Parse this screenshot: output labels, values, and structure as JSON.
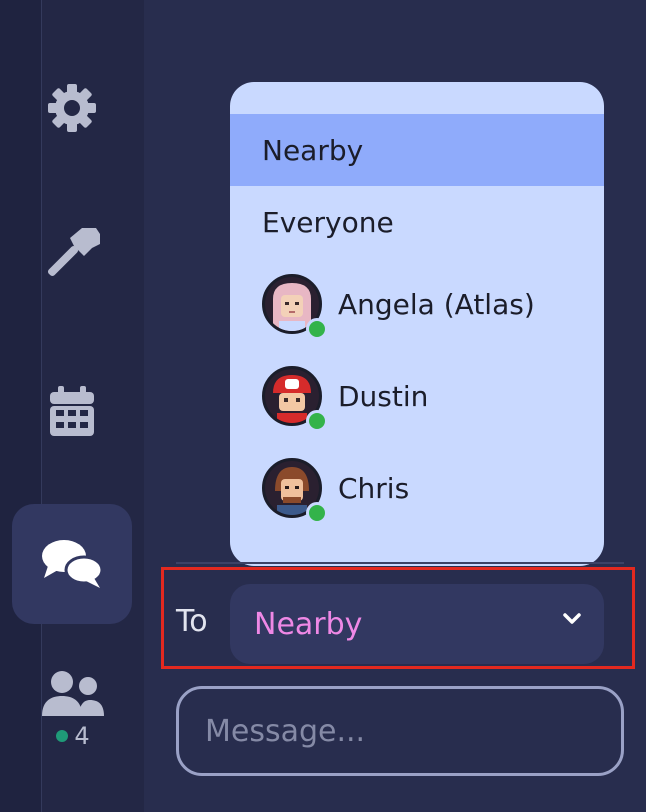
{
  "sidebar": {
    "items": [
      {
        "name": "settings",
        "icon": "gear-icon"
      },
      {
        "name": "build",
        "icon": "hammer-icon"
      },
      {
        "name": "calendar",
        "icon": "calendar-icon"
      },
      {
        "name": "chat",
        "icon": "chat-bubbles-icon",
        "active": true
      },
      {
        "name": "participants",
        "icon": "people-icon"
      }
    ],
    "online_count": "4"
  },
  "dropdown": {
    "options": [
      {
        "label": "Nearby",
        "selected": true
      },
      {
        "label": "Everyone"
      }
    ],
    "users": [
      {
        "name": "Angela (Atlas)",
        "status": "online"
      },
      {
        "name": "Dustin",
        "status": "online"
      },
      {
        "name": "Chris",
        "status": "online"
      }
    ]
  },
  "recipient": {
    "label": "To",
    "value": "Nearby"
  },
  "message": {
    "placeholder": "Message..."
  },
  "colors": {
    "background": "#282d4e",
    "sidebar": "#232745",
    "dropdown_bg": "#c9d9ff",
    "selected_option": "#8fabfb",
    "recipient_value": "#ef88e6",
    "online_status": "#33b34a",
    "highlight": "#e3291f"
  }
}
